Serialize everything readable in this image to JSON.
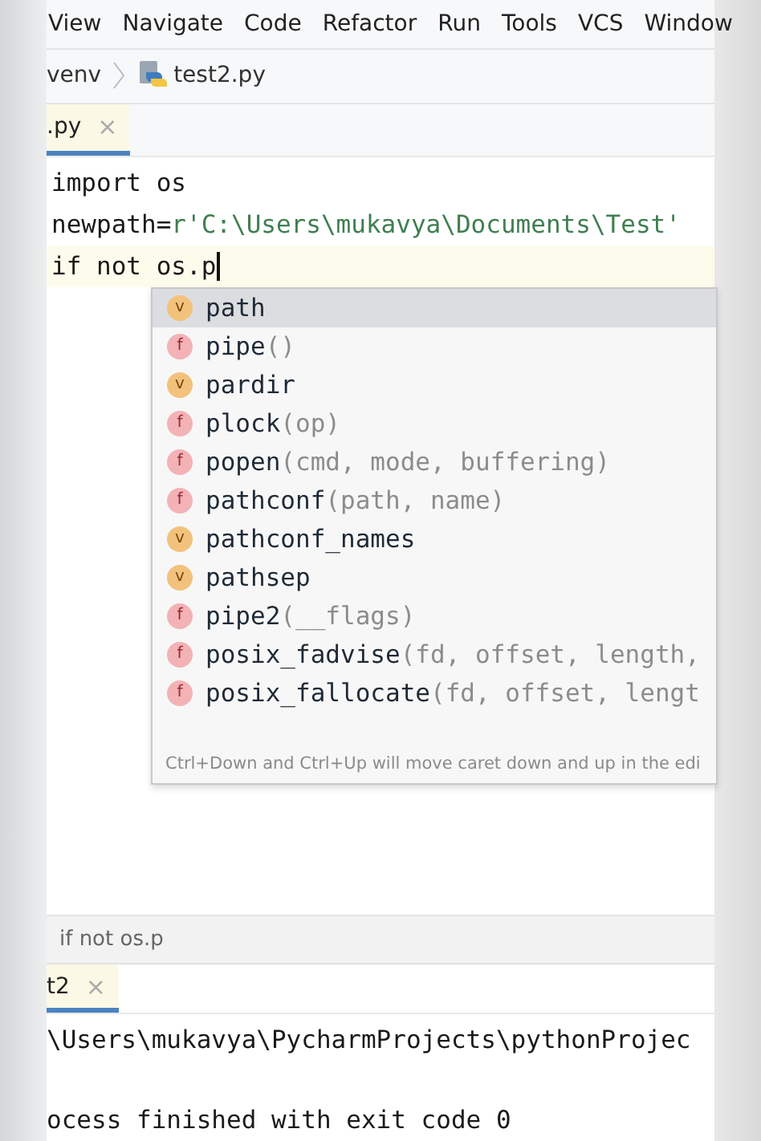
{
  "menu": [
    {
      "label": "View"
    },
    {
      "label": "Navigate"
    },
    {
      "label": "Code"
    },
    {
      "label": "Refactor"
    },
    {
      "label": "Run"
    },
    {
      "label": "Tools"
    },
    {
      "label": "VCS"
    },
    {
      "label": "Window"
    }
  ],
  "breadcrumbs": [
    "venv",
    "test2.py"
  ],
  "editor_tabs": [
    {
      "label": ".py",
      "close": "×",
      "selected": true
    }
  ],
  "code": [
    {
      "current": false,
      "tokens": [
        {
          "kind": "plain",
          "text": "import os"
        }
      ]
    },
    {
      "current": false,
      "tokens": [
        {
          "kind": "plain",
          "text": "newpath="
        },
        {
          "kind": "string",
          "text": "r'C:\\Users\\mukavya\\Documents\\Test'"
        }
      ]
    },
    {
      "current": true,
      "tokens": [
        {
          "kind": "plain",
          "text": "if not os.p"
        }
      ]
    }
  ],
  "completion": {
    "items": [
      {
        "kind": "variable",
        "badge": "v",
        "name": "path",
        "selected": true
      },
      {
        "kind": "function",
        "badge": "f",
        "name": "pipe",
        "params": "()",
        "selected": false
      },
      {
        "kind": "variable",
        "badge": "v",
        "name": "pardir",
        "selected": false
      },
      {
        "kind": "function",
        "badge": "f",
        "name": "plock",
        "params": "(op)",
        "selected": false
      },
      {
        "kind": "function",
        "badge": "f",
        "name": "popen",
        "params": "(cmd, mode, buffering)",
        "selected": false
      },
      {
        "kind": "function",
        "badge": "f",
        "name": "pathconf",
        "params": "(path, name)",
        "selected": false
      },
      {
        "kind": "variable",
        "badge": "v",
        "name": "pathconf_names",
        "selected": false
      },
      {
        "kind": "variable",
        "badge": "v",
        "name": "pathsep",
        "selected": false
      },
      {
        "kind": "function",
        "badge": "f",
        "name": "pipe2",
        "params": "(__flags)",
        "selected": false
      },
      {
        "kind": "function",
        "badge": "f",
        "name": "posix_fadvise",
        "params": "(fd, offset, length,",
        "selected": false
      },
      {
        "kind": "function",
        "badge": "f",
        "name": "posix_fallocate",
        "params": "(fd, offset, lengt",
        "selected": false
      }
    ],
    "hint": "Ctrl+Down and Ctrl+Up will move caret down and up in the edi"
  },
  "status_breadcrumb": "if not os.p",
  "run_tabs": [
    {
      "label": "t2",
      "close": "×",
      "selected": true
    }
  ],
  "console": [
    "\\Users\\mukavya\\PycharmProjects\\pythonProjec",
    "ocess finished with exit code 0"
  ]
}
